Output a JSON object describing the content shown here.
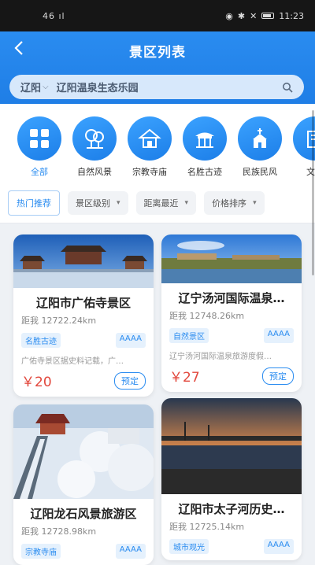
{
  "status": {
    "time": "11:23",
    "signal": "46 ıl"
  },
  "header": {
    "title": "景区列表"
  },
  "search": {
    "city": "辽阳",
    "query": "辽阳温泉生态乐园"
  },
  "categories": [
    {
      "label": "全部",
      "icon": "grid-icon"
    },
    {
      "label": "自然风景",
      "icon": "tree-icon"
    },
    {
      "label": "宗教寺庙",
      "icon": "temple-icon"
    },
    {
      "label": "名胜古迹",
      "icon": "pavilion-icon"
    },
    {
      "label": "民族民风",
      "icon": "church-icon"
    },
    {
      "label": "文化",
      "icon": "building-icon"
    }
  ],
  "filters": [
    {
      "label": "热门推荐"
    },
    {
      "label": "景区级别"
    },
    {
      "label": "距离最近"
    },
    {
      "label": "价格排序"
    }
  ],
  "cards": [
    {
      "name": "辽阳市广佑寺景区",
      "distance": "距我 12722.24km",
      "tag": "名胜古迹",
      "level": "AAAA",
      "desc": "广佑寺景区据史料记载，广…",
      "price": "￥20",
      "book": "预定"
    },
    {
      "name": "辽宁汤河国际温泉…",
      "distance": "距我 12748.26km",
      "tag": "自然景区",
      "level": "AAAA",
      "desc": "辽宁汤河国际温泉旅游度假…",
      "price": "￥27",
      "book": "预定"
    },
    {
      "name": "辽阳龙石风景旅游区",
      "distance": "距我 12728.98km",
      "tag": "宗教寺庙",
      "level": "AAAA"
    },
    {
      "name": "辽阳市太子河历史…",
      "distance": "距我 12725.14km",
      "tag": "城市观光",
      "level": "AAAA"
    }
  ]
}
